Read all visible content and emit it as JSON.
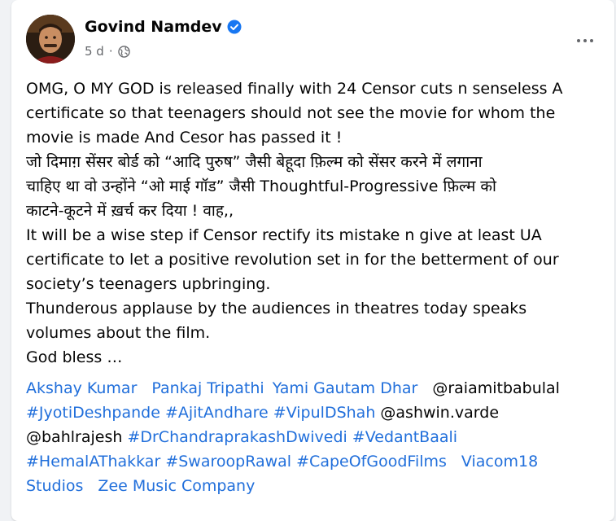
{
  "post": {
    "author": "Govind Namdev",
    "verified": true,
    "time": "5 d",
    "audience_icon": "globe-icon",
    "more_icon": "more-options-icon",
    "text_lines": [
      "OMG, O MY GOD is released finally with 24 Censor cuts n senseless A",
      "certificate so that teenagers should not see the movie for whom the",
      "movie is made And Cesor has passed it !",
      "जो दिमाग़ सेंसर बोर्ड को “आदि पुरुष” जैसी बेहूदा फ़िल्म को सेंसर करने में लगाना",
      "चाहिए था वो उन्होंने “ओ माई गॉड” जैसी Thoughtful-Progressive फ़िल्म को",
      "काटने-कूटने में ख़र्च कर दिया ! वाह,,",
      "It will be a wise step if Censor rectify its mistake n give at least UA",
      "certificate to let a positive revolution set in for the betterment of our",
      "society’s teenagers upbringing.",
      "Thunderous applause by the audiences in theatres today speaks",
      "volumes about the film.",
      "God bless …"
    ],
    "tags": [
      "Akshay Kumar",
      "Pankaj Tripathi",
      "Yami Gautam Dhar",
      "@raiamitbabulal",
      "#JyotiDeshpande",
      "#AjitAndhare",
      "#VipulDShah",
      "@ashwin.varde",
      "@bahlrajesh",
      "#DrChandraprakashDwivedi",
      "#VedantBaali",
      "#HemalAThakkar",
      "#SwaroopRawal",
      "#CapeOfGoodFilms",
      "Viacom18",
      "Studios",
      "Zee Music Company"
    ]
  },
  "colors": {
    "link": "#216fdb",
    "text": "#050505",
    "secondary": "#65676b",
    "verified_badge": "#1877f2",
    "background": "#f0f2f5"
  }
}
